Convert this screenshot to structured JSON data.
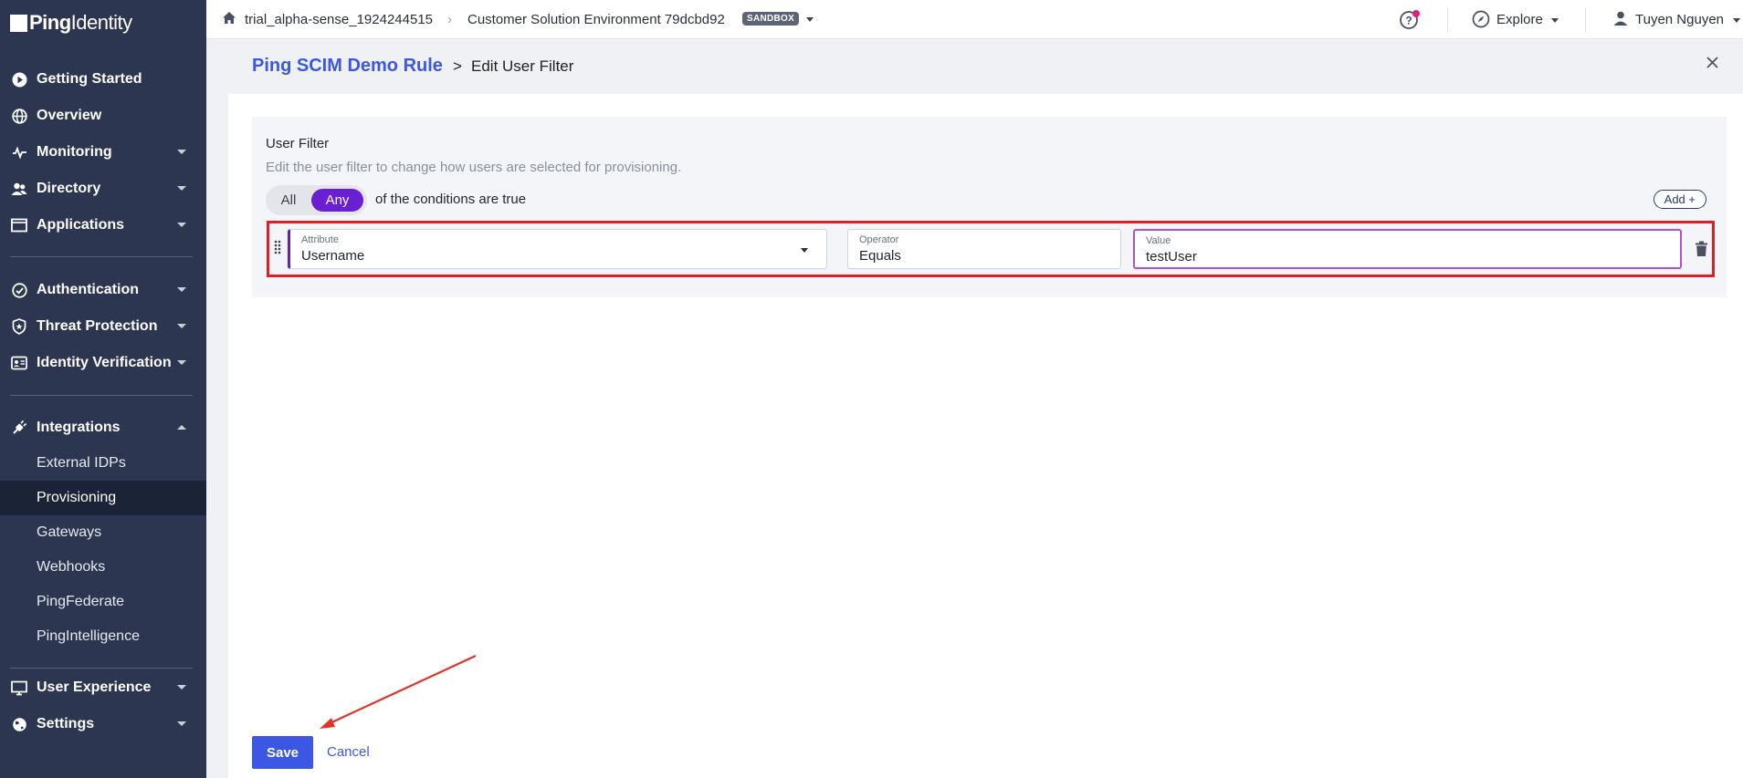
{
  "brand": {
    "logo_bold": "Ping",
    "logo_regular": "Identity"
  },
  "topbar": {
    "org": "trial_alpha-sense_1924244515",
    "environment": "Customer Solution Environment 79dcbd92",
    "badge": "SANDBOX",
    "explore_label": "Explore",
    "user_name": "Tuyen Nguyen"
  },
  "sidebar": {
    "items": [
      {
        "label": "Getting Started",
        "icon": "play-circle-icon"
      },
      {
        "label": "Overview",
        "icon": "globe-icon"
      },
      {
        "label": "Monitoring",
        "icon": "pulse-icon"
      },
      {
        "label": "Directory",
        "icon": "users-icon"
      },
      {
        "label": "Applications",
        "icon": "window-icon"
      },
      {
        "label": "Authentication",
        "icon": "check-circle-icon"
      },
      {
        "label": "Threat Protection",
        "icon": "shield-icon"
      },
      {
        "label": "Identity Verification",
        "icon": "id-card-icon"
      },
      {
        "label": "Integrations",
        "icon": "plug-icon"
      },
      {
        "label": "User Experience",
        "icon": "monitor-icon"
      },
      {
        "label": "Settings",
        "icon": "globe-icon"
      }
    ],
    "sub_items": [
      {
        "label": "External IDPs"
      },
      {
        "label": "Provisioning"
      },
      {
        "label": "Gateways"
      },
      {
        "label": "Webhooks"
      },
      {
        "label": "PingFederate"
      },
      {
        "label": "PingIntelligence"
      }
    ]
  },
  "page": {
    "breadcrumb_link": "Ping SCIM Demo Rule",
    "breadcrumb_sep": ">",
    "breadcrumb_current": "Edit User Filter"
  },
  "filter": {
    "title": "User Filter",
    "description": "Edit the user filter to change how users are selected for provisioning.",
    "toggle_all": "All",
    "toggle_any": "Any",
    "selected": "Any",
    "condition_text": "of the conditions are true",
    "add_label": "Add +",
    "row": {
      "attribute_label": "Attribute",
      "attribute_value": "Username",
      "operator_label": "Operator",
      "operator_value": "Equals",
      "value_label": "Value",
      "value_value": "testUser"
    }
  },
  "actions": {
    "save_label": "Save",
    "cancel_label": "Cancel"
  },
  "colors": {
    "sidebar_bg": "#2c3650",
    "accent": "#3b57e3",
    "toggle_active": "#6a1fd1",
    "highlight": "#e01e28"
  }
}
